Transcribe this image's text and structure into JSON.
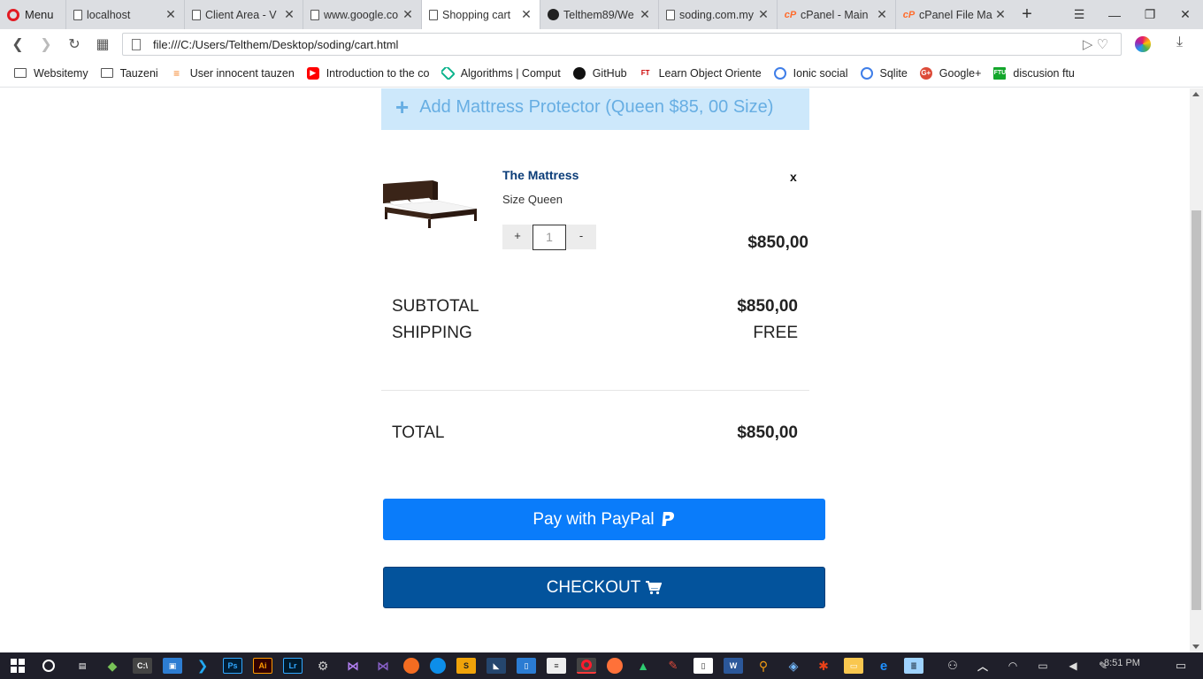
{
  "browser": {
    "menu_label": "Menu",
    "tabs": [
      {
        "title": "localhost",
        "icon": "page-icon"
      },
      {
        "title": "Client Area - V",
        "icon": "page-icon"
      },
      {
        "title": "www.google.co",
        "icon": "page-icon"
      },
      {
        "title": "Shopping cart",
        "icon": "page-icon",
        "active": true
      },
      {
        "title": "Telthem89/We",
        "icon": "github-icon"
      },
      {
        "title": "soding.com.my",
        "icon": "page-icon"
      },
      {
        "title": "cPanel - Main",
        "icon": "cpanel-icon"
      },
      {
        "title": "cPanel File Ma",
        "icon": "cpanel-icon"
      }
    ],
    "url": "file:///C:/Users/Telthem/Desktop/soding/cart.html",
    "bookmarks": [
      {
        "label": "Websitemy",
        "icon": "folder"
      },
      {
        "label": "Tauzeni",
        "icon": "folder"
      },
      {
        "label": "User innocent tauzen",
        "icon": "stackoverflow"
      },
      {
        "label": "Introduction to the co",
        "icon": "youtube"
      },
      {
        "label": "Algorithms | Comput",
        "icon": "algorithms"
      },
      {
        "label": "GitHub",
        "icon": "github"
      },
      {
        "label": "Learn Object Oriente",
        "icon": "ft"
      },
      {
        "label": "Ionic social",
        "icon": "ring"
      },
      {
        "label": "Sqlite",
        "icon": "ring"
      },
      {
        "label": "Google+",
        "icon": "gplus"
      },
      {
        "label": "discusion ftu",
        "icon": "ftu"
      }
    ],
    "colors": {
      "accent_opera": "#e21b23",
      "tabstrip": "#dcdee2"
    }
  },
  "cart": {
    "protector_label": "Add Mattress Protector (Queen $85, 00 Size)",
    "item": {
      "name": "The Mattress",
      "size": "Size Queen",
      "quantity": "1",
      "qty_plus": "+",
      "qty_minus": "-",
      "price": "$850,00",
      "remove": "x"
    },
    "summary": {
      "subtotal_label": "SUBTOTAL",
      "subtotal_value": "$850,00",
      "shipping_label": "SHIPPING",
      "shipping_value": "FREE",
      "total_label": "TOTAL",
      "total_value": "$850,00"
    },
    "paypal_label": "Pay with PayPal",
    "checkout_label": "CHECKOUT",
    "colors": {
      "paypal": "#0a7cfa",
      "checkout": "#03539c",
      "protector_bg": "#cde8fb",
      "protector_text": "#67aee3",
      "product_name": "#0a3c78"
    }
  },
  "taskbar": {
    "time": "8:51 PM"
  }
}
